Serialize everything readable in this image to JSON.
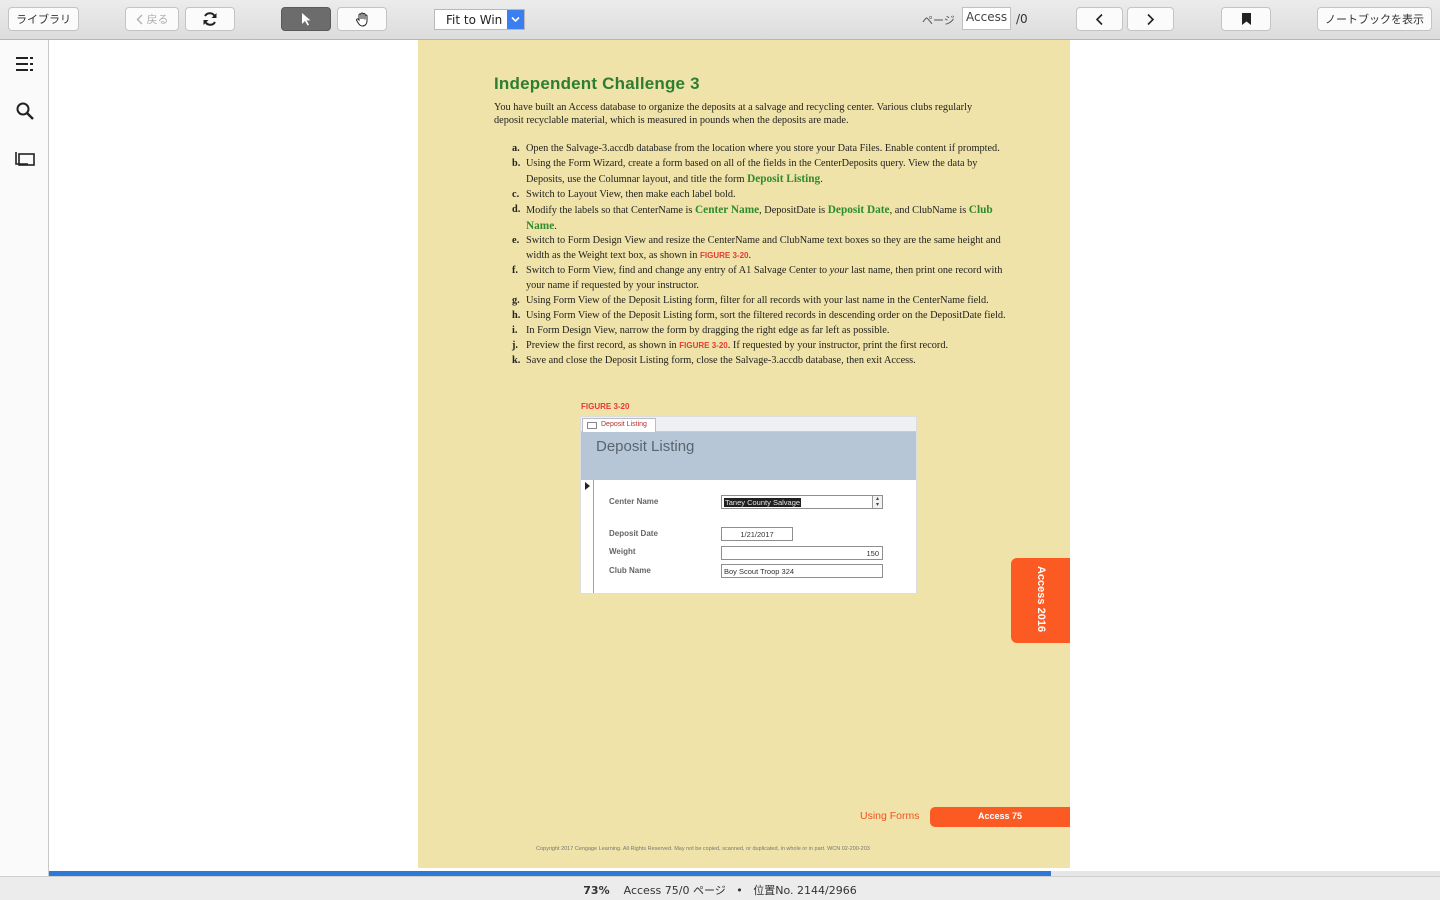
{
  "toolbar": {
    "library_label": "ライブラリ",
    "back_label": "戻る",
    "zoom_value": "Fit to Win",
    "page_label": "ページ",
    "page_input_value": "Access",
    "page_total": "/0",
    "notebook_label": "ノートブックを表示"
  },
  "sidebar": {
    "items": [
      {
        "icon": "table-of-contents-icon"
      },
      {
        "icon": "search-icon"
      },
      {
        "icon": "flashcards-icon"
      }
    ]
  },
  "page": {
    "title": "Independent Challenge 3",
    "intro": "You have built an Access database to organize the deposits at a salvage and recycling center. Various clubs regularly deposit recyclable material, which is measured in pounds when the deposits are made.",
    "steps": [
      {
        "letter": "a.",
        "text": "Open the Salvage-3.accdb database from the location where you store your Data Files. Enable content if prompted."
      },
      {
        "letter": "b.",
        "text_pre": "Using the Form Wizard, create a form based on all of the fields in the CenterDeposits query. View the data by Deposits, use the Columnar layout, and title the form ",
        "term": "Deposit Listing",
        "text_post": "."
      },
      {
        "letter": "c.",
        "text": "Switch to Layout View, then make each label bold."
      },
      {
        "letter": "d.",
        "text_1": "Modify the labels so that CenterName is ",
        "term_1": "Center Name",
        "text_2": ", DepositDate is ",
        "term_2": "Deposit Date",
        "text_3": ", and ClubName is ",
        "term_3": "Club Name",
        "text_4": "."
      },
      {
        "letter": "e.",
        "text_pre": "Switch to Form Design View and resize the CenterName and ClubName text boxes so they are the same height and width as the Weight text box, as shown in ",
        "ref": "FIGURE 3-20",
        "text_post": "."
      },
      {
        "letter": "f.",
        "text_pre": "Switch to Form View, find and change any entry of A1 Salvage Center to ",
        "emph": "your",
        "text_post": " last name, then print one record with your name if requested by your instructor."
      },
      {
        "letter": "g.",
        "text": "Using Form View of the Deposit Listing form, filter for all records with your last name in the CenterName field."
      },
      {
        "letter": "h.",
        "text": "Using Form View of the Deposit Listing form, sort the filtered records in descending order on the DepositDate field."
      },
      {
        "letter": "i.",
        "text": "In Form Design View, narrow the form by dragging the right edge as far left as possible."
      },
      {
        "letter": "j.",
        "text_pre": "Preview the first record, as shown in ",
        "ref": "FIGURE 3-20",
        "text_post": ". If requested by your instructor, print the first record."
      },
      {
        "letter": "k.",
        "text": "Save and close the Deposit Listing form, close the Salvage-3.accdb database, then exit Access."
      }
    ],
    "figure": {
      "caption": "FIGURE 3-20",
      "tab_label": "Deposit Listing",
      "header_title": "Deposit Listing",
      "fields": [
        {
          "label": "Center Name",
          "value": "Taney County Salvage"
        },
        {
          "label": "Deposit Date",
          "value": "1/21/2017"
        },
        {
          "label": "Weight",
          "value": "150"
        },
        {
          "label": "Club Name",
          "value": "Boy Scout Troop 324"
        }
      ]
    },
    "side_tab": "Access 2016",
    "footer_section": "Using Forms",
    "footer_page": "Access 75",
    "copyright": "Copyright 2017 Cengage Learning. All Rights Reserved. May not be copied, scanned, or duplicated, in whole or in part. WCN 02-200-203"
  },
  "progress": {
    "fraction": 0.72
  },
  "status": {
    "percent": "73%",
    "location": "Access 75/0 ページ",
    "dot": "•",
    "position": "位置No. 2144/2966"
  },
  "colors": {
    "page_bg": "#efe3a9",
    "accent_green": "#2e7d32",
    "accent_orange": "#fb5a22",
    "figure_red": "#e53935",
    "progress_blue": "#2d7ad6"
  }
}
